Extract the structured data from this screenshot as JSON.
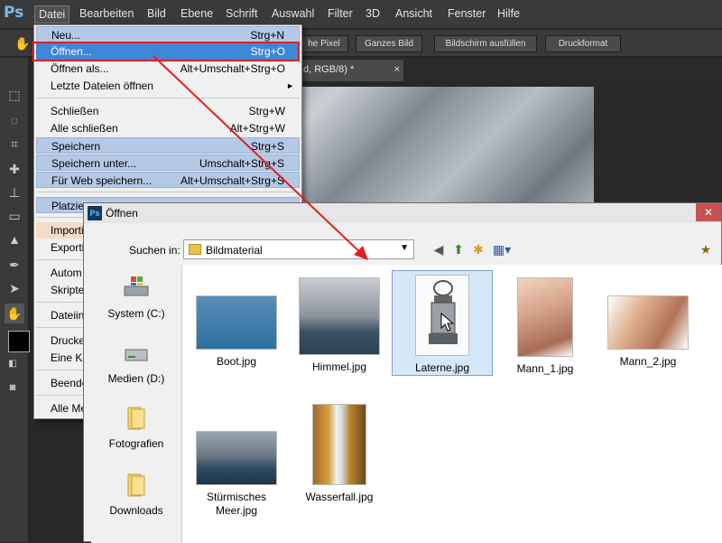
{
  "menubar": {
    "logo": "Ps",
    "items": [
      "Datei",
      "Bearbeiten",
      "Bild",
      "Ebene",
      "Schrift",
      "Auswahl",
      "Filter",
      "3D",
      "Ansicht",
      "Fenster",
      "Hilfe"
    ]
  },
  "optionsbar": {
    "buttons": [
      "he Pixel",
      "Ganzes Bild",
      "Bildschirm ausfüllen",
      "Druckformat"
    ]
  },
  "document_tab": {
    "title": "d, RGB/8) *",
    "close": "×"
  },
  "datei_menu": {
    "items": [
      {
        "label": "Neu...",
        "shortcut": "Strg+N"
      },
      {
        "label": "Öffnen...",
        "shortcut": "Strg+O"
      },
      {
        "label": "Öffnen als...",
        "shortcut": "Alt+Umschalt+Strg+O"
      },
      {
        "label": "Letzte Dateien öffnen",
        "shortcut": "►"
      },
      {
        "label": "Schließen",
        "shortcut": "Strg+W"
      },
      {
        "label": "Alle schließen",
        "shortcut": "Alt+Strg+W"
      },
      {
        "label": "Speichern",
        "shortcut": "Strg+S"
      },
      {
        "label": "Speichern unter...",
        "shortcut": "Umschalt+Strg+S"
      },
      {
        "label": "Für Web speichern...",
        "shortcut": "Alt+Umschalt+Strg+S"
      },
      {
        "label": "Platzier",
        "shortcut": ""
      },
      {
        "label": "Importi",
        "shortcut": ""
      },
      {
        "label": "Exportie",
        "shortcut": ""
      },
      {
        "label": "Autom",
        "shortcut": ""
      },
      {
        "label": "Skripter",
        "shortcut": ""
      },
      {
        "label": "Dateiinf",
        "shortcut": ""
      },
      {
        "label": "Drucke",
        "shortcut": ""
      },
      {
        "label": "Eine Ko",
        "shortcut": ""
      },
      {
        "label": "Beende",
        "shortcut": ""
      },
      {
        "label": "Alle Me",
        "shortcut": ""
      }
    ]
  },
  "dialog": {
    "title": "Öffnen",
    "close": "✕",
    "look_in_label": "Suchen in:",
    "look_in_value": "Bildmaterial",
    "sidebar": [
      {
        "label": "System (C:)",
        "icon": "windows-drive-icon"
      },
      {
        "label": "Medien (D:)",
        "icon": "drive-icon"
      },
      {
        "label": "Fotografien",
        "icon": "folder-icon"
      },
      {
        "label": "Downloads",
        "icon": "folder-icon"
      }
    ],
    "files": [
      {
        "name": "Boot.jpg"
      },
      {
        "name": "Himmel.jpg"
      },
      {
        "name": "Laterne.jpg",
        "selected": true
      },
      {
        "name": "Mann_1.jpg"
      },
      {
        "name": "Mann_2.jpg"
      },
      {
        "name": "Stürmisches Meer.jpg"
      },
      {
        "name": "Wasserfall.jpg"
      }
    ]
  }
}
